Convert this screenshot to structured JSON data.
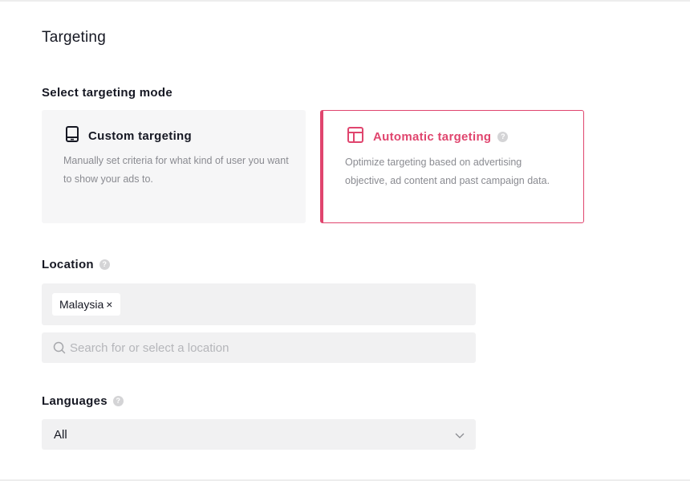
{
  "page": {
    "title": "Targeting"
  },
  "targeting_mode": {
    "label": "Select targeting mode",
    "options": [
      {
        "title": "Custom targeting",
        "description": "Manually set criteria for what kind of user you want to show your ads to.",
        "icon": "tablet-icon",
        "selected": false
      },
      {
        "title": "Automatic targeting",
        "description": "Optimize targeting based on advertising objective, ad content and past campaign data.",
        "icon": "layout-icon",
        "selected": true
      }
    ]
  },
  "location": {
    "label": "Location",
    "selected_tags": [
      "Malaysia"
    ],
    "tag_remove_glyph": "×",
    "search_placeholder": "Search for or select a location",
    "search_value": ""
  },
  "languages": {
    "label": "Languages",
    "value": "All"
  },
  "help_glyph": "?",
  "colors": {
    "accent": "#e0456e",
    "field_bg": "#f1f1f2",
    "card_bg": "#f6f6f7",
    "muted_text": "#8a8b91",
    "placeholder": "#b5b6ba"
  }
}
